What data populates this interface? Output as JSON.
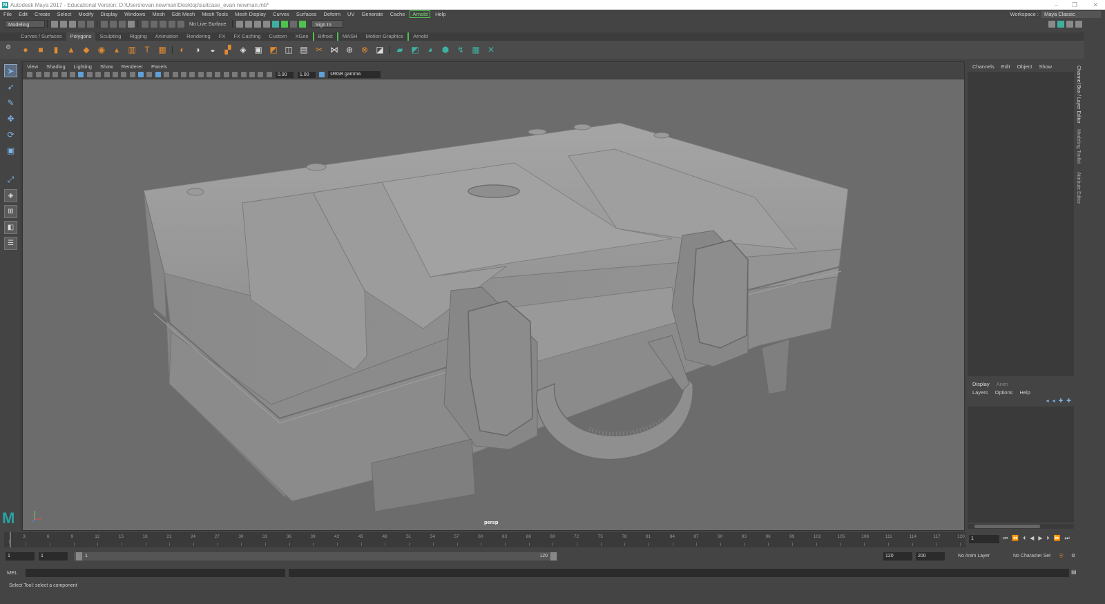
{
  "app": {
    "title": "Autodesk Maya 2017 - Educational Version: D:\\Users\\evan.newman\\Desktop\\suitcase_evan newman.mb*",
    "logo_letter": "M"
  },
  "window_controls": {
    "minimize": "–",
    "restore": "❐",
    "close": "✕"
  },
  "menubar": {
    "items": [
      "File",
      "Edit",
      "Create",
      "Select",
      "Modify",
      "Display",
      "Windows",
      "Mesh",
      "Edit Mesh",
      "Mesh Tools",
      "Mesh Display",
      "Curves",
      "Surfaces",
      "Deform",
      "UV",
      "Generate",
      "Cache",
      "Arnold",
      "Help"
    ],
    "highlighted": "Arnold"
  },
  "workspace": {
    "label": "Workspace :",
    "value": "Maya Classic"
  },
  "statusline": {
    "mode": "Modeling",
    "live_surface": "No Live Surface",
    "signin": "Sign In"
  },
  "shelf_tabs": {
    "items": [
      "Curves / Surfaces",
      "Polygons",
      "Sculpting",
      "Rigging",
      "Animation",
      "Rendering",
      "FX",
      "FX Caching",
      "Custom",
      "XGen",
      "Bifrost",
      "MASH",
      "Motion Graphics",
      "Arnold"
    ],
    "active": "Polygons"
  },
  "shelf_icons": {
    "poly": [
      "poly-sphere-icon",
      "poly-cube-icon",
      "poly-cylinder-icon",
      "poly-cone-icon",
      "poly-plane-icon",
      "poly-torus-icon",
      "poly-pyramid-icon",
      "poly-pipe-icon",
      "poly-text-icon",
      "poly-svg-icon"
    ],
    "ops": [
      "combine-icon",
      "separate-icon",
      "smooth-icon",
      "mirror-icon",
      "boolean-icon",
      "extrude-icon",
      "bevel-icon",
      "bridge-icon",
      "insert-edge-loop-icon",
      "multi-cut-icon",
      "target-weld-icon",
      "merge-icon",
      "fill-hole-icon",
      "quad-draw-icon"
    ],
    "uv": [
      "planar-uv-icon",
      "cylindrical-uv-icon",
      "spherical-uv-icon",
      "automatic-uv-icon",
      "uv-editor-icon",
      "checker-icon",
      "unfold-icon"
    ]
  },
  "tools": [
    "select-tool-icon",
    "lasso-tool-icon",
    "paint-select-icon",
    "move-tool-icon",
    "rotate-tool-icon",
    "scale-tool-icon",
    "soft-select-icon",
    "show-manipulator-icon",
    "single-perspective-icon",
    "four-view-icon",
    "outliner-icon",
    "layout-icon"
  ],
  "viewport": {
    "menu": [
      "View",
      "Shading",
      "Lighting",
      "Show",
      "Renderer",
      "Panels"
    ],
    "exposure": "0.00",
    "gamma": "1.00",
    "color_space": "sRGB gamma",
    "camera": "persp",
    "bg_color": "#6c6c6c",
    "model_color": "#8c8c8c"
  },
  "channel_box": {
    "menu": [
      "Channels",
      "Edit",
      "Object",
      "Show"
    ]
  },
  "layer_editor": {
    "tabs": [
      "Display",
      "Anim"
    ],
    "active_tab": "Display",
    "menu": [
      "Layers",
      "Options",
      "Help"
    ]
  },
  "side_tabs": [
    "Channel Box / Layer Editor",
    "Modeling Toolkit",
    "Attribute Editor"
  ],
  "timeslider": {
    "ticks": [
      3,
      6,
      9,
      12,
      15,
      18,
      21,
      24,
      27,
      30,
      33,
      36,
      39,
      42,
      45,
      48,
      51,
      54,
      57,
      60,
      63,
      66,
      69,
      72,
      75,
      78,
      81,
      84,
      87,
      90,
      93,
      96,
      99,
      102,
      105,
      108,
      111,
      114,
      117,
      120
    ],
    "first_frame": "1",
    "min": 1,
    "max": 120,
    "current_frame": "1"
  },
  "range_slider": {
    "start": "1",
    "playback_start": "1",
    "range_start_label": "1",
    "range_end_label": "120",
    "playback_end": "120",
    "end": "200",
    "anim_layer": "No Anim Layer",
    "character_set": "No Character Set"
  },
  "command_line": {
    "label": "MEL"
  },
  "help_line": {
    "text": "Select Tool: select a component"
  }
}
